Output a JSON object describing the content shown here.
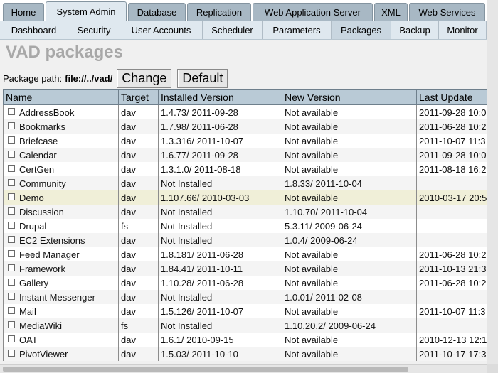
{
  "top_tabs": [
    {
      "label": "Home"
    },
    {
      "label": "System Admin"
    },
    {
      "label": "Database"
    },
    {
      "label": "Replication"
    },
    {
      "label": "Web Application Server"
    },
    {
      "label": "XML"
    },
    {
      "label": "Web Services"
    }
  ],
  "sub_tabs": [
    {
      "label": "Dashboard"
    },
    {
      "label": "Security"
    },
    {
      "label": "User Accounts"
    },
    {
      "label": "Scheduler"
    },
    {
      "label": "Parameters"
    },
    {
      "label": "Packages"
    },
    {
      "label": "Backup"
    },
    {
      "label": "Monitor"
    }
  ],
  "page_title": "VAD packages",
  "path": {
    "label": "Package path:",
    "value": "file://../vad/",
    "change_label": "Change",
    "default_label": "Default"
  },
  "table": {
    "headers": [
      "Name",
      "Target",
      "Installed Version",
      "New Version",
      "Last Update"
    ],
    "rows": [
      {
        "name": "AddressBook",
        "target": "dav",
        "installed": "1.4.73/ 2011-09-28",
        "new": "Not available",
        "last": "2011-09-28 10:0"
      },
      {
        "name": "Bookmarks",
        "target": "dav",
        "installed": "1.7.98/ 2011-06-28",
        "new": "Not available",
        "last": "2011-06-28 10:2"
      },
      {
        "name": "Briefcase",
        "target": "dav",
        "installed": "1.3.316/ 2011-10-07",
        "new": "Not available",
        "last": "2011-10-07 11:3"
      },
      {
        "name": "Calendar",
        "target": "dav",
        "installed": "1.6.77/ 2011-09-28",
        "new": "Not available",
        "last": "2011-09-28 10:0"
      },
      {
        "name": "CertGen",
        "target": "dav",
        "installed": "1.3.1.0/ 2011-08-18",
        "new": "Not available",
        "last": "2011-08-18 16:2"
      },
      {
        "name": "Community",
        "target": "dav",
        "installed": "Not Installed",
        "new": "1.8.33/ 2011-10-04",
        "last": ""
      },
      {
        "name": "Demo",
        "target": "dav",
        "installed": "1.107.66/ 2010-03-03",
        "new": "Not available",
        "last": "2010-03-17 20:5"
      },
      {
        "name": "Discussion",
        "target": "dav",
        "installed": "Not Installed",
        "new": "1.10.70/ 2011-10-04",
        "last": ""
      },
      {
        "name": "Drupal",
        "target": "fs",
        "installed": "Not Installed",
        "new": "5.3.11/ 2009-06-24",
        "last": ""
      },
      {
        "name": "EC2 Extensions",
        "target": "dav",
        "installed": "Not Installed",
        "new": "1.0.4/ 2009-06-24",
        "last": ""
      },
      {
        "name": "Feed Manager",
        "target": "dav",
        "installed": "1.8.181/ 2011-06-28",
        "new": "Not available",
        "last": "2011-06-28 10:2"
      },
      {
        "name": "Framework",
        "target": "dav",
        "installed": "1.84.41/ 2011-10-11",
        "new": "Not available",
        "last": "2011-10-13 21:3"
      },
      {
        "name": "Gallery",
        "target": "dav",
        "installed": "1.10.28/ 2011-06-28",
        "new": "Not available",
        "last": "2011-06-28 10:2"
      },
      {
        "name": "Instant Messenger",
        "target": "dav",
        "installed": "Not Installed",
        "new": "1.0.01/ 2011-02-08",
        "last": ""
      },
      {
        "name": "Mail",
        "target": "dav",
        "installed": "1.5.126/ 2011-10-07",
        "new": "Not available",
        "last": "2011-10-07 11:3"
      },
      {
        "name": "MediaWiki",
        "target": "fs",
        "installed": "Not Installed",
        "new": "1.10.20.2/ 2009-06-24",
        "last": ""
      },
      {
        "name": "OAT",
        "target": "dav",
        "installed": "1.6.1/ 2010-09-15",
        "new": "Not available",
        "last": "2010-12-13 12:1"
      },
      {
        "name": "PivotViewer",
        "target": "dav",
        "installed": "1.5.03/ 2011-10-10",
        "new": "Not available",
        "last": "2011-10-17 17:3"
      }
    ]
  },
  "colors": {
    "tab_bg": "#a8b8c4",
    "active_tab_bg": "#dfe8ef",
    "header_bg": "#b9cad6",
    "highlight_row": "#f0efd8",
    "title_gray": "#a8a8a8"
  }
}
